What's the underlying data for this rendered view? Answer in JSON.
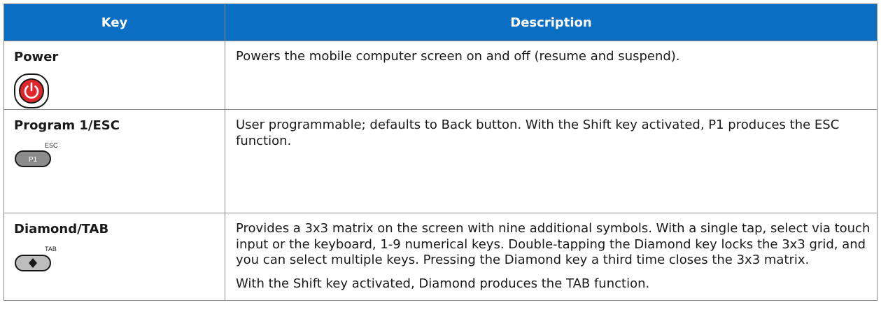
{
  "table": {
    "headers": {
      "key": "Key",
      "description": "Description"
    },
    "rows": [
      {
        "key": "Power",
        "icon": "power-button-icon",
        "description": "Powers the mobile computer screen on and off (resume and suspend)."
      },
      {
        "key": "Program 1/ESC",
        "icon": "p1-key-icon",
        "icon_label": "P1",
        "icon_superscript": "ESC",
        "description": "User programmable; defaults to Back button. With the Shift key activated, P1 produces the ESC function."
      },
      {
        "key": "Diamond/TAB",
        "icon": "diamond-key-icon",
        "icon_superscript": "TAB",
        "description": "Provides a 3x3 matrix on the screen with nine additional symbols. With a single tap, select via touch input or the keyboard, 1-9 numerical keys. Double-tapping the Diamond key locks the 3x3 grid, and you can select multiple keys. Pressing the Diamond key a third time closes the 3x3 matrix.",
        "note": "With the Shift key activated, Diamond produces the TAB function."
      }
    ]
  },
  "colors": {
    "header_background": "#0a6fc2",
    "header_text": "#ffffff",
    "power_red": "#e0262b",
    "key_gray": "#8c8c8c"
  }
}
